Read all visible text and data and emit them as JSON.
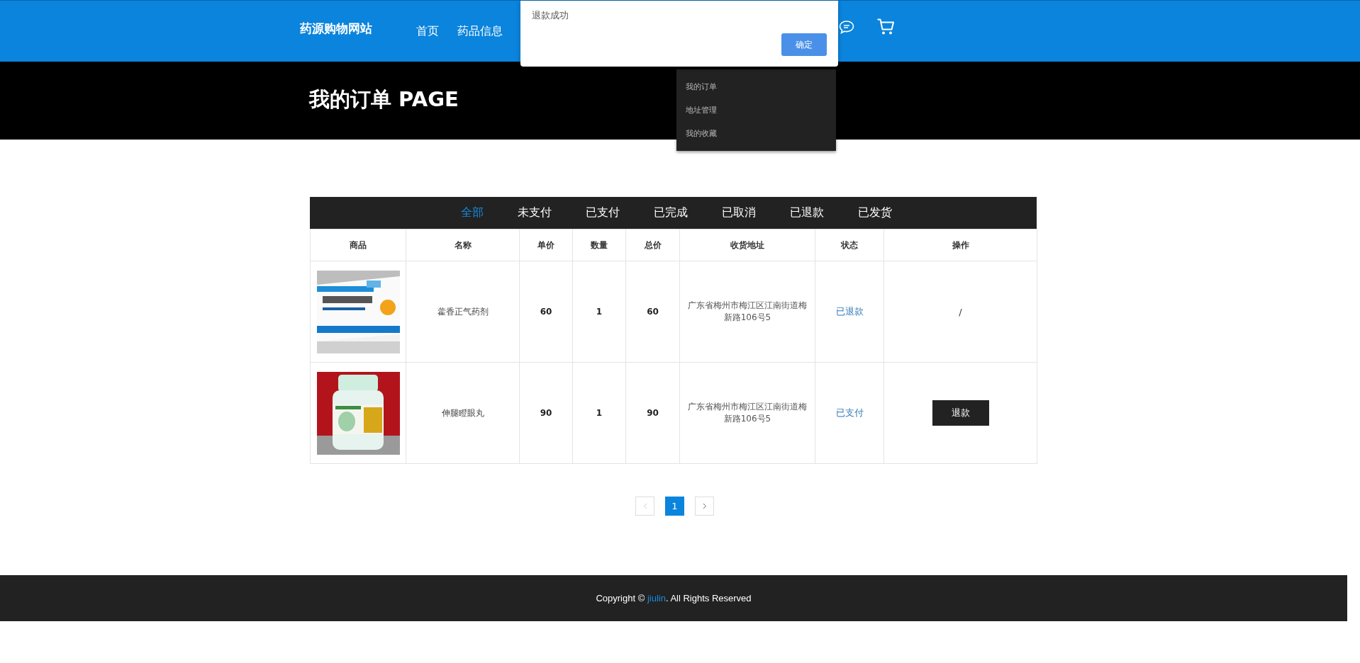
{
  "header": {
    "logo": "药源购物网站",
    "nav": [
      {
        "label": "首页"
      },
      {
        "label": "药品信息"
      }
    ]
  },
  "dialog": {
    "message": "退款成功",
    "button": "确定"
  },
  "user_menu": {
    "items": [
      {
        "label": "我的订单"
      },
      {
        "label": "地址管理"
      },
      {
        "label": "我的收藏"
      }
    ]
  },
  "banner": {
    "title": "我的订单 PAGE"
  },
  "tabs": [
    {
      "label": "全部",
      "selected": true
    },
    {
      "label": "未支付",
      "selected": false
    },
    {
      "label": "已支付",
      "selected": false
    },
    {
      "label": "已完成",
      "selected": false
    },
    {
      "label": "已取消",
      "selected": false
    },
    {
      "label": "已退款",
      "selected": false
    },
    {
      "label": "已发货",
      "selected": false
    }
  ],
  "table": {
    "columns": [
      "商品",
      "名称",
      "单价",
      "数量",
      "总价",
      "收货地址",
      "状态",
      "操作"
    ],
    "rows": [
      {
        "name": "藿香正气药剂",
        "price": "60",
        "quantity": "1",
        "total": "60",
        "address": "广东省梅州市梅江区江南街道梅新路106号5",
        "status": "已退款",
        "action": {
          "kind": "text",
          "label": "/"
        }
      },
      {
        "name": "伸腿瞪眼丸",
        "price": "90",
        "quantity": "1",
        "total": "90",
        "address": "广东省梅州市梅江区江南街道梅新路106号5",
        "status": "已支付",
        "action": {
          "kind": "button",
          "label": "退款"
        }
      }
    ]
  },
  "pagination": {
    "pages": [
      {
        "label": "1",
        "selected": true
      }
    ]
  },
  "footer": {
    "prefix": "Copyright © ",
    "link": "jiulin",
    "suffix": ". All Rights Reserved"
  }
}
